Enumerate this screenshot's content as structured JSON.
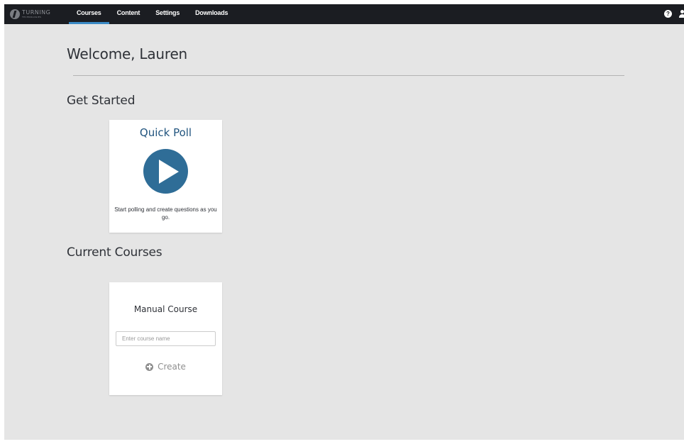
{
  "app": {
    "logo": {
      "text": "TURNING",
      "subtext": "TECHNOLOGIES"
    }
  },
  "nav": {
    "items": [
      {
        "label": "Courses",
        "active": true
      },
      {
        "label": "Content",
        "active": false
      },
      {
        "label": "Settings",
        "active": false
      },
      {
        "label": "Downloads",
        "active": false
      }
    ],
    "help_icon": "help-icon",
    "help_glyph": "?",
    "user_icon": "user-icon"
  },
  "main": {
    "welcome": "Welcome, Lauren",
    "get_started": {
      "title": "Get Started",
      "quick_poll": {
        "title": "Quick Poll",
        "icon": "play-icon",
        "description": "Start polling and create questions as you go."
      }
    },
    "current_courses": {
      "title": "Current Courses",
      "manual_course": {
        "title": "Manual Course",
        "input_value": "",
        "input_placeholder": "Enter course name",
        "create_icon": "plus-circle-icon",
        "create_label": "Create"
      }
    }
  },
  "colors": {
    "topbar": "#1b1d22",
    "nav_active_underline": "#3a8ac5",
    "page_background": "#e5e5e5",
    "quick_poll_title": "#22557f",
    "play_button": "#2f6d97",
    "create_disabled": "#8f8f8f"
  }
}
